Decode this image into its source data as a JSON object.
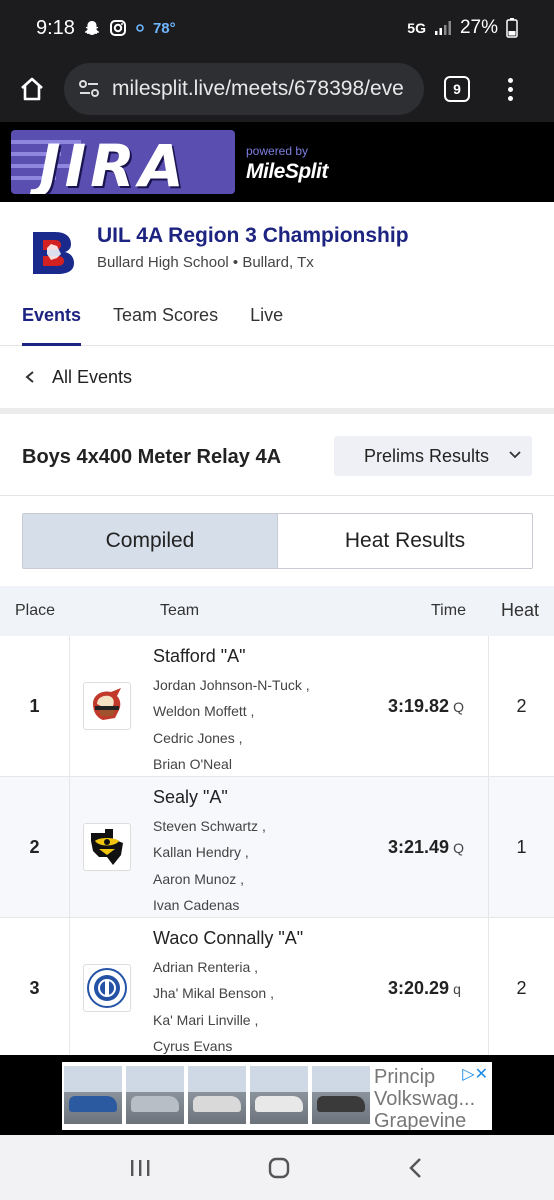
{
  "status_bar": {
    "time": "9:18",
    "temperature": "78°",
    "network": "5G",
    "battery": "27%"
  },
  "browser": {
    "url": "milesplit.live/meets/678398/eve",
    "tab_count": "9"
  },
  "banner": {
    "logo_text": "JIRA",
    "powered_by": "powered by",
    "brand": "MileSplit"
  },
  "meet": {
    "title": "UIL 4A Region 3 Championship",
    "subtitle": "Bullard High School • Bullard, Tx"
  },
  "nav_tabs": [
    {
      "label": "Events",
      "active": true
    },
    {
      "label": "Team Scores",
      "active": false
    },
    {
      "label": "Live",
      "active": false
    }
  ],
  "back_link": "All Events",
  "event": {
    "title": "Boys 4x400 Meter Relay 4A",
    "round_selected": "Prelims Results"
  },
  "view_toggle": {
    "compiled": "Compiled",
    "heat_results": "Heat Results"
  },
  "table": {
    "headers": {
      "place": "Place",
      "team": "Team",
      "time": "Time",
      "heat": "Heat"
    },
    "rows": [
      {
        "place": "1",
        "team": "Stafford \"A\"",
        "athletes": [
          "Jordan Johnson-N-Tuck ,",
          "Weldon Moffett ,",
          "Cedric Jones ,",
          "Brian O'Neal"
        ],
        "time": "3:19.82",
        "qualifier": "Q",
        "heat": "2"
      },
      {
        "place": "2",
        "team": "Sealy \"A\"",
        "athletes": [
          "Steven Schwartz ,",
          "Kallan Hendry ,",
          "Aaron Munoz ,",
          "Ivan Cadenas"
        ],
        "time": "3:21.49",
        "qualifier": "Q",
        "heat": "1"
      },
      {
        "place": "3",
        "team": "Waco Connally \"A\"",
        "athletes": [
          "Adrian Renteria ,",
          "Jha' Mikal Benson ,",
          "Ka' Mari Linville ,",
          "Cyrus Evans"
        ],
        "time": "3:20.29",
        "qualifier": "q",
        "heat": "2"
      }
    ]
  },
  "ad": {
    "text_line1": "Princip",
    "text_line2": "Volkswag...",
    "text_line3": "Grapevine"
  },
  "colors": {
    "accent": "#1d2380",
    "status_bar_bg": "#1c1c1e",
    "table_header_bg": "#f0f3f8",
    "toggle_active_bg": "#d6deea"
  }
}
